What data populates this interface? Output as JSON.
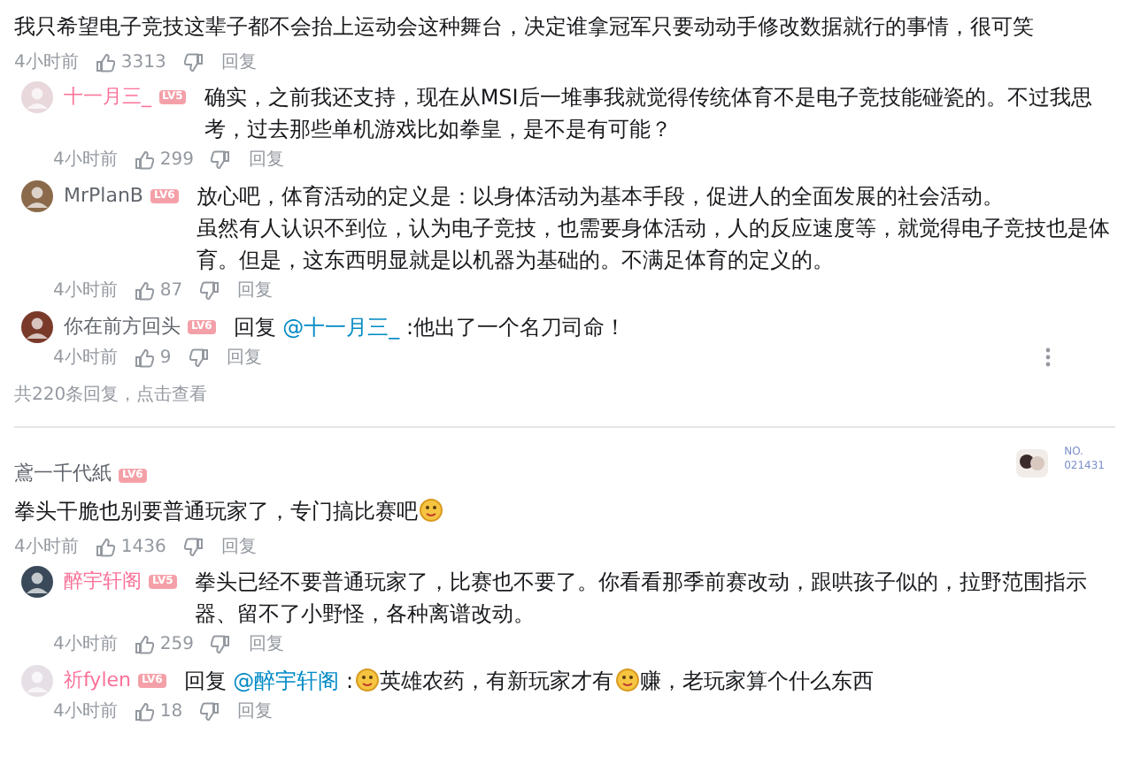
{
  "threads": [
    {
      "content": [
        [
          {
            "kind": "text",
            "text": "我只希望电子竞技这辈子都不会抬上运动会这种舞台，决定谁拿冠军只要动动手修改数据就行的事情，很可笑"
          }
        ]
      ],
      "meta": {
        "time": "4小时前",
        "likes": "3313",
        "reply": "回复"
      },
      "replies": [
        {
          "name": "十一月三_",
          "vip": true,
          "level": "LV5",
          "content": [
            [
              {
                "kind": "text",
                "text": "确实，之前我还支持，现在从MSI后一堆事我就觉得传统体育不是电子竞技能碰瓷的。不过我思考，过去那些单机游戏比如拳皇，是不是有可能？"
              }
            ]
          ],
          "meta": {
            "time": "4小时前",
            "likes": "299",
            "reply": "回复"
          },
          "more": false
        },
        {
          "name": "MrPlanB",
          "vip": false,
          "level": "LV6",
          "content": [
            [
              {
                "kind": "text",
                "text": "放心吧，体育活动的定义是：以身体活动为基本手段，促进人的全面发展的社会活动。"
              }
            ],
            [
              {
                "kind": "text",
                "text": "虽然有人认识不到位，认为电子竞技，也需要身体活动，人的反应速度等，就觉得电子竞技也是体育。但是，这东西明显就是以机器为基础的。不满足体育的定义的。"
              }
            ]
          ],
          "meta": {
            "time": "4小时前",
            "likes": "87",
            "reply": "回复"
          },
          "more": false
        },
        {
          "name": "你在前方回头",
          "vip": false,
          "level": "LV6",
          "content": [
            [
              {
                "kind": "text",
                "text": "回复 "
              },
              {
                "kind": "mention",
                "text": "@十一月三_"
              },
              {
                "kind": "text",
                "text": " :他出了一个名刀司命！"
              }
            ]
          ],
          "meta": {
            "time": "4小时前",
            "likes": "9",
            "reply": "回复"
          },
          "more": true
        }
      ],
      "more_replies": "共220条回复，点击查看"
    },
    {
      "author": {
        "name": "鳶一千代紙",
        "level": "LV6"
      },
      "fan_badge": {
        "label": "NO.",
        "number": "021431"
      },
      "content": [
        [
          {
            "kind": "text",
            "text": "拳头干脆也别要普通玩家了，专门搞比赛吧"
          },
          {
            "kind": "sticker"
          }
        ]
      ],
      "meta": {
        "time": "4小时前",
        "likes": "1436",
        "reply": "回复"
      },
      "replies": [
        {
          "name": "醉宇轩阁",
          "vip": true,
          "level": "LV5",
          "content": [
            [
              {
                "kind": "text",
                "text": "拳头已经不要普通玩家了，比赛也不要了。你看看那季前赛改动，跟哄孩子似的，拉野范围指示器、留不了小野怪，各种离谱改动。"
              }
            ]
          ],
          "meta": {
            "time": "4小时前",
            "likes": "259",
            "reply": "回复"
          },
          "more": false
        },
        {
          "name": "祈fylen",
          "vip": true,
          "level": "LV6",
          "content": [
            [
              {
                "kind": "text",
                "text": "回复 "
              },
              {
                "kind": "mention",
                "text": "@醉宇轩阁"
              },
              {
                "kind": "text",
                "text": " :"
              },
              {
                "kind": "sticker"
              },
              {
                "kind": "text",
                "text": "英雄农药，有新玩家才有"
              },
              {
                "kind": "sticker"
              },
              {
                "kind": "text",
                "text": "赚，老玩家算个什么东西"
              }
            ]
          ],
          "meta": {
            "time": "4小时前",
            "likes": "18",
            "reply": "回复"
          },
          "more": false
        }
      ]
    }
  ]
}
